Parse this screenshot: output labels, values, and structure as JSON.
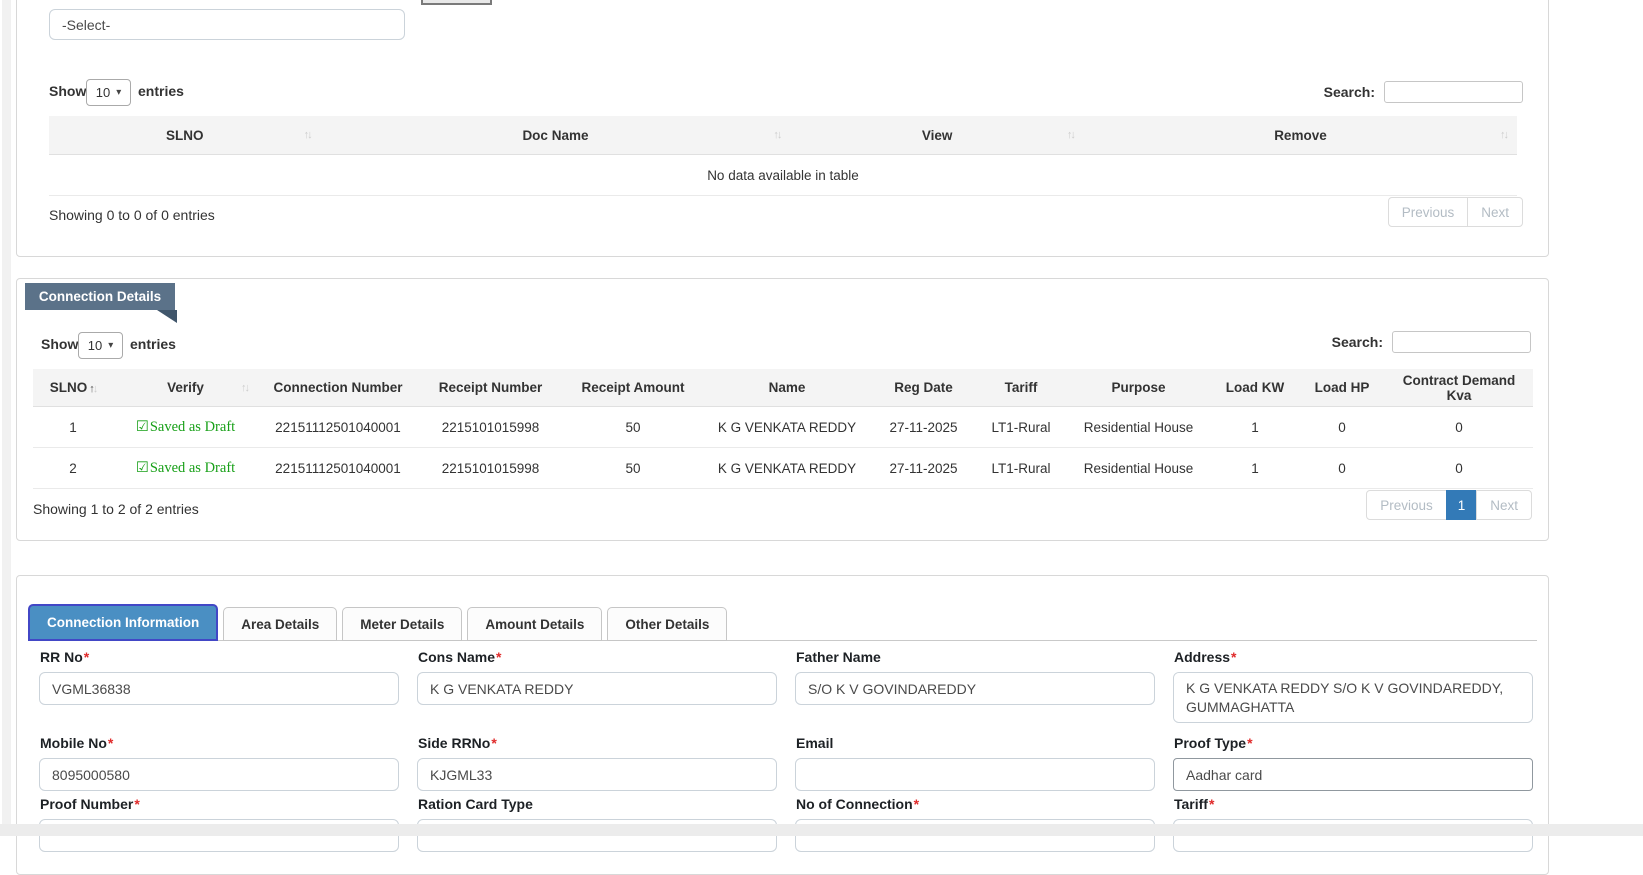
{
  "icons": {
    "sort_asc": "↑",
    "sort_desc": "↓",
    "dropdown_caret": "▾",
    "checkbox_checked": "☑"
  },
  "docs_panel": {
    "doc_type_select_value": "-Select-",
    "table": {
      "show_label": "Show",
      "page_size": "10",
      "entries_label": "entries",
      "search_label": "Search:",
      "columns": [
        "SLNO",
        "Doc Name",
        "View",
        "Remove"
      ],
      "empty_message": "No data available in table",
      "info": "Showing 0 to 0 of 0 entries",
      "previous_label": "Previous",
      "next_label": "Next"
    }
  },
  "connection_details": {
    "title": "Connection Details",
    "table": {
      "show_label": "Show",
      "page_size": "10",
      "entries_label": "entries",
      "search_label": "Search:",
      "columns": [
        "SLNO",
        "Verify",
        "Connection Number",
        "Receipt Number",
        "Receipt Amount",
        "Name",
        "Reg Date",
        "Tariff",
        "Purpose",
        "Load KW",
        "Load HP",
        "Contract Demand Kva"
      ],
      "rows": [
        {
          "slno": "1",
          "verify": "Saved as Draft",
          "connection_number": "22151112501040001",
          "receipt_number": "2215101015998",
          "receipt_amount": "50",
          "name": "K G VENKATA REDDY",
          "reg_date": "27-11-2025",
          "tariff": "LT1-Rural",
          "purpose": "Residential House",
          "load_kw": "1",
          "load_hp": "0",
          "contract_demand_kva": "0"
        },
        {
          "slno": "2",
          "verify": "Saved as Draft",
          "connection_number": "22151112501040001",
          "receipt_number": "2215101015998",
          "receipt_amount": "50",
          "name": "K G VENKATA REDDY",
          "reg_date": "27-11-2025",
          "tariff": "LT1-Rural",
          "purpose": "Residential House",
          "load_kw": "1",
          "load_hp": "0",
          "contract_demand_kva": "0"
        }
      ],
      "info": "Showing 1 to 2 of 2 entries",
      "previous_label": "Previous",
      "current_page": "1",
      "next_label": "Next"
    }
  },
  "tabs": [
    {
      "label": "Connection Information",
      "active": true
    },
    {
      "label": "Area Details",
      "active": false
    },
    {
      "label": "Meter Details",
      "active": false
    },
    {
      "label": "Amount Details",
      "active": false
    },
    {
      "label": "Other Details",
      "active": false
    }
  ],
  "form": {
    "required_marker": "*",
    "fields": [
      {
        "label": "RR No",
        "required": true,
        "value": "VGML36838"
      },
      {
        "label": "Cons Name",
        "required": true,
        "value": "K G VENKATA REDDY"
      },
      {
        "label": "Father Name",
        "required": false,
        "value": "S/O K V GOVINDAREDDY"
      },
      {
        "label": "Address",
        "required": true,
        "value": "K G VENKATA REDDY S/O K V GOVINDAREDDY,\nGUMMAGHATTA"
      },
      {
        "label": "Mobile No",
        "required": true,
        "value": "8095000580"
      },
      {
        "label": "Side RRNo",
        "required": true,
        "value": "KJGML33"
      },
      {
        "label": "Email",
        "required": false,
        "value": ""
      },
      {
        "label": "Proof Type",
        "required": true,
        "value": "Aadhar card"
      },
      {
        "label": "Proof Number",
        "required": true,
        "value": ""
      },
      {
        "label": "Ration Card Type",
        "required": false,
        "value": ""
      },
      {
        "label": "No of Connection",
        "required": true,
        "value": ""
      },
      {
        "label": "Tariff",
        "required": true,
        "value": ""
      }
    ]
  },
  "colors": {
    "active_tab": "#4a8fc3",
    "active_tab_border": "#4247c6",
    "ribbon": "#5b7289",
    "pagination_active": "#337ab7",
    "verify_green": "#18a018",
    "required_red": "#e02b2b"
  }
}
